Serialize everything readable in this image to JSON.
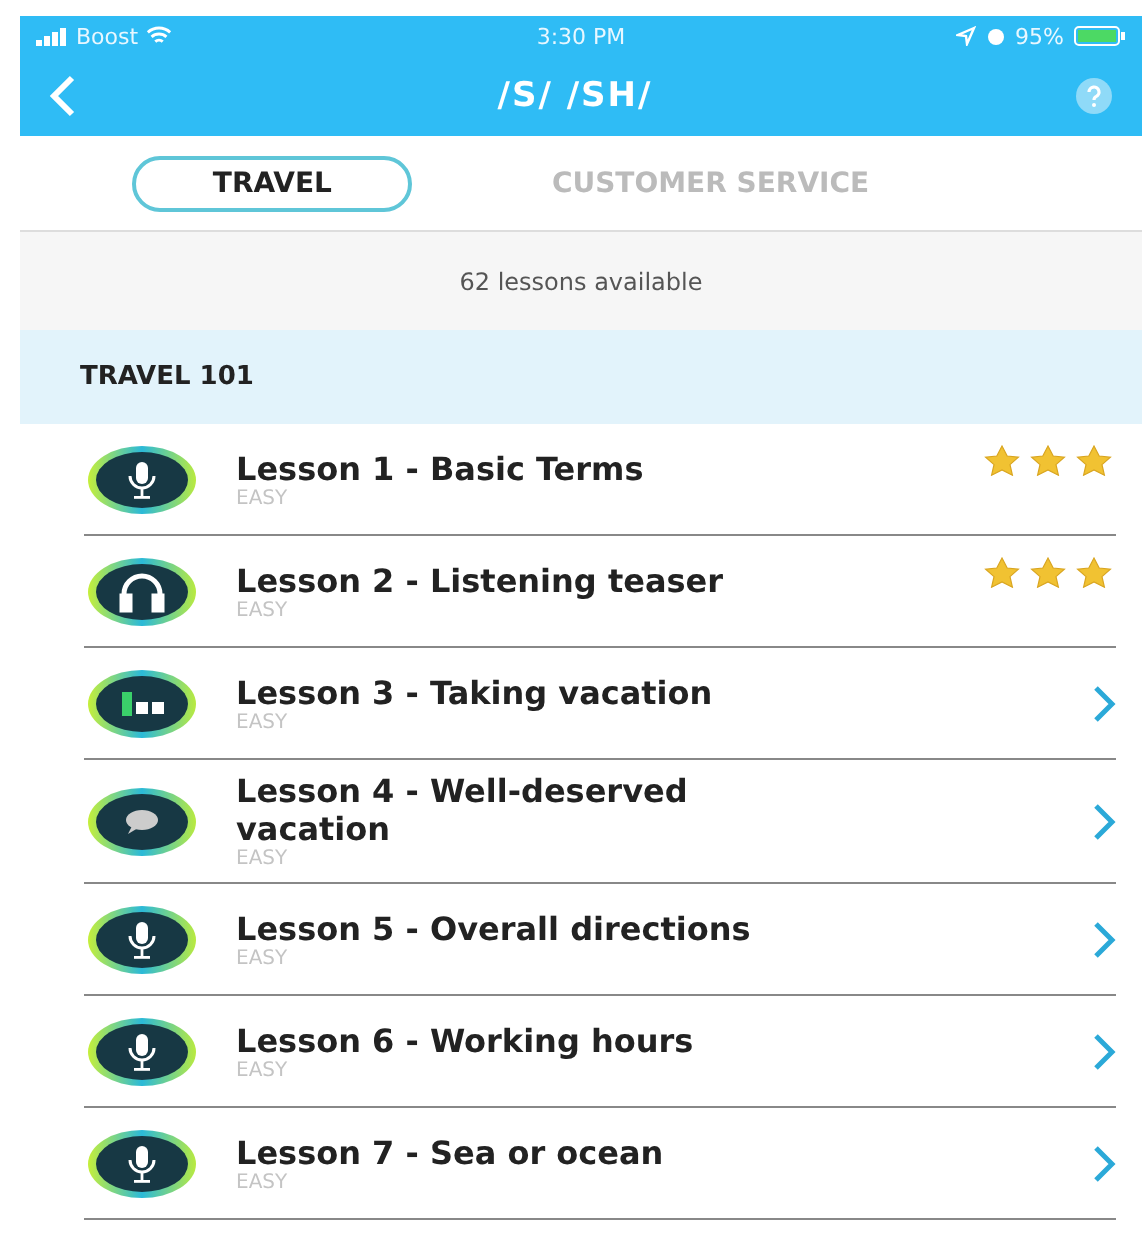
{
  "status_bar": {
    "carrier": "Boost",
    "time": "3:30 PM",
    "battery": "95%"
  },
  "header": {
    "title": "/S/ /SH/"
  },
  "tabs": [
    {
      "label": "TRAVEL",
      "selected": true
    },
    {
      "label": "CUSTOMER SERVICE",
      "selected": false
    }
  ],
  "lessons_count": "62 lessons available",
  "section": {
    "title": "TRAVEL 101"
  },
  "lessons": [
    {
      "title": "Lesson 1 - Basic Terms",
      "level": "EASY",
      "kind": "mic",
      "stars": 3
    },
    {
      "title": "Lesson 2 - Listening teaser",
      "level": "EASY",
      "kind": "headphones",
      "stars": 3
    },
    {
      "title": "Lesson 3 - Taking vacation",
      "level": "EASY",
      "kind": "bars"
    },
    {
      "title": "Lesson 4 - Well-deserved vacation",
      "level": "EASY",
      "kind": "chat"
    },
    {
      "title": "Lesson 5 - Overall directions",
      "level": "EASY",
      "kind": "mic"
    },
    {
      "title": "Lesson 6 - Working hours",
      "level": "EASY",
      "kind": "mic"
    },
    {
      "title": "Lesson 7 - Sea or ocean",
      "level": "EASY",
      "kind": "mic"
    }
  ]
}
